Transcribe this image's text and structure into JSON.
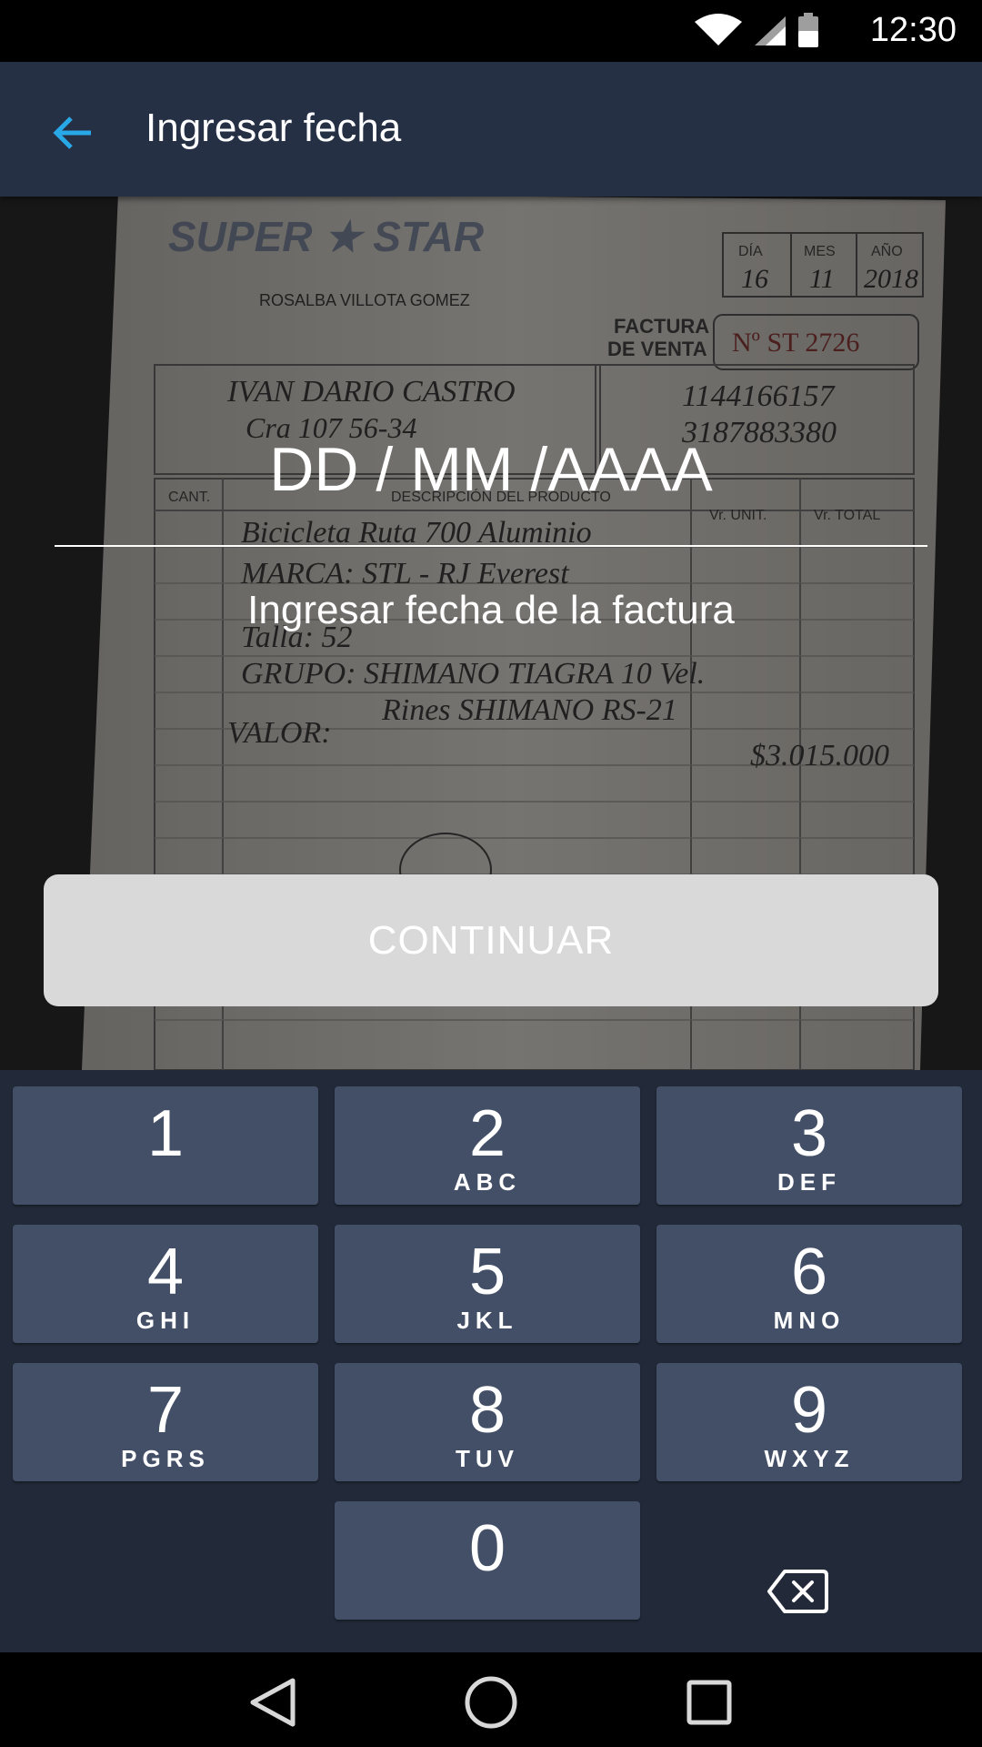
{
  "status_bar": {
    "time": "12:30",
    "icons": [
      "wifi-icon",
      "signal-icon",
      "battery-icon"
    ]
  },
  "app_bar": {
    "title": "Ingresar fecha",
    "back_icon": "arrow-left-icon",
    "accent_color": "#29a8e8",
    "background_color": "#263045"
  },
  "form": {
    "date_value": "",
    "date_placeholder": "DD / MM /AAAA",
    "helper": "Ingresar fecha de la factura",
    "continue_label": "CONTINUAR"
  },
  "receipt_image": {
    "brand": "SUPER STAR",
    "owner": "ROSALBA VILLOTA GOMEZ",
    "doc_type": "FACTURA DE VENTA",
    "invoice_number": "Nº ST 2726",
    "date_headers": [
      "DÍA",
      "MES",
      "AÑO"
    ],
    "date_values": [
      "16",
      "11",
      "2018"
    ],
    "customer": "IVAN DARIO CASTRO",
    "column_headers": [
      "CANT.",
      "DESCRIPCIÓN DEL PRODUCTO",
      "Vr. UNIT.",
      "Vr. TOTAL"
    ],
    "handwritten_lines": [
      "Bicicleta Ruta 700 Aluminio",
      "MARCA: STL - RJ Everest",
      "Talla: 52",
      "GRUPO: SHIMANO TIAGRA 10 Vel.",
      "Rines SHIMANO RS-21",
      "VALOR:"
    ],
    "total": "$3.015.000"
  },
  "keypad": {
    "keys": [
      {
        "num": "1",
        "letters": ""
      },
      {
        "num": "2",
        "letters": "ABC"
      },
      {
        "num": "3",
        "letters": "DEF"
      },
      {
        "num": "4",
        "letters": "GHI"
      },
      {
        "num": "5",
        "letters": "JKL"
      },
      {
        "num": "6",
        "letters": "MNO"
      },
      {
        "num": "7",
        "letters": "PGRS"
      },
      {
        "num": "8",
        "letters": "TUV"
      },
      {
        "num": "9",
        "letters": "WXYZ"
      },
      {
        "num": "0",
        "letters": ""
      }
    ],
    "backspace_icon": "backspace-icon"
  },
  "nav_bar": {
    "icons": [
      "back-triangle-icon",
      "home-circle-icon",
      "recents-square-icon"
    ]
  }
}
